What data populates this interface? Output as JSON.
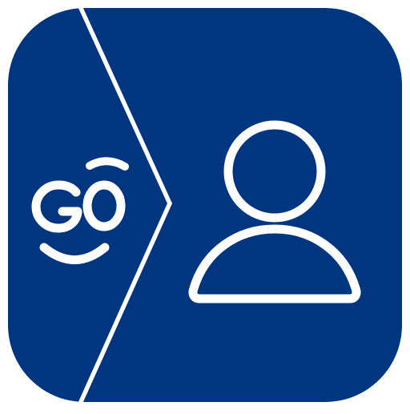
{
  "app_icon": {
    "logo_text": "GO",
    "colors": {
      "tile": "#003580",
      "stroke": "#ffffff"
    },
    "icons": [
      "go-smile-logo",
      "user-icon"
    ]
  }
}
